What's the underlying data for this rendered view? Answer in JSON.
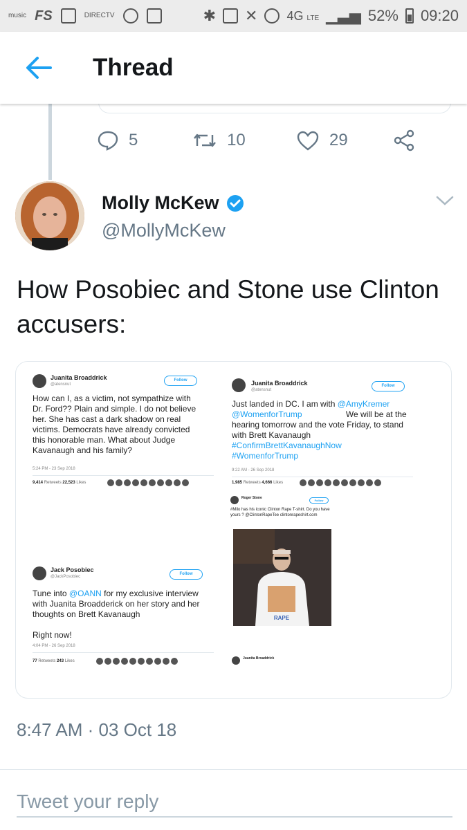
{
  "status_bar": {
    "left_tiny": "music",
    "left_fs": "FS",
    "left_directv": "DIRECTV",
    "network": "4G",
    "network_sub": "LTE",
    "battery": "52%",
    "time": "09:20"
  },
  "header": {
    "title": "Thread"
  },
  "previous_tweet": {
    "replies": "5",
    "retweets": "10",
    "likes": "29"
  },
  "tweet": {
    "author_name": "Molly McKew",
    "handle": "@MollyMcKew",
    "verified": true,
    "text": "How Posobiec and Stone use Clinton accusers:",
    "timestamp": "8:47 AM · 03 Oct 18"
  },
  "embedded": {
    "t1": {
      "name": "Juanita Broaddrick",
      "handle": "@atensnut",
      "follow": "Follow",
      "body": "How can I, as a victim, not sympathize with Dr. Ford?? Plain and simple. I do not believe her.  She has cast a dark shadow on real victims. Democrats have already convicted this honorable man.  What about Judge Kavanaugh and his family?",
      "date": "5:24 PM - 23 Sep 2018",
      "retweets": "9,414",
      "retweets_label": "Retweets",
      "likes": "22,523",
      "likes_label": "Likes"
    },
    "t2": {
      "name": "Juanita Broaddrick",
      "handle": "@atensnut",
      "follow": "Follow",
      "body_1": "Just landed in DC. I am with ",
      "mention_1": "@AmyKremer",
      "mention_2": "@WomenforTrump",
      "body_2": "We will be at the hearing tomorrow and the vote Friday, to stand with Brett Kavanaugh",
      "hashtag_1": "#ConfirmBrettKavanaughNow",
      "hashtag_2": "#WomenforTrump",
      "date": "9:22 AM - 26 Sep 2018",
      "retweets": "1,985",
      "retweets_label": "Retweets",
      "likes": "4,666",
      "likes_label": "Likes"
    },
    "t3": {
      "name": "Roger Stone",
      "follow": "Follow",
      "body": "#Milo has his iconic Clinton Rape T-shirt. Do you have yours ? @ClintonRapeTee clintonrapeshirt.com",
      "shirt_text": "RAPE"
    },
    "t4": {
      "name": "Jack Posobiec",
      "handle": "@JackPosobiec",
      "follow": "Follow",
      "body_1": "Tune into ",
      "mention": "@OANN",
      "body_2": " for my exclusive interview with Juanita Broadderick on her story and her thoughts on Brett Kavanaugh",
      "body_3": "Right now!",
      "date": "4:04 PM - 26 Sep 2018",
      "retweets": "77",
      "retweets_label": "Retweets",
      "likes": "243",
      "likes_label": "Likes"
    },
    "t5": {
      "name": "Juanita Broaddrick"
    }
  },
  "reply": {
    "placeholder": "Tweet your reply"
  },
  "colors": {
    "accent": "#1da1f2",
    "text": "#14171a",
    "secondary": "#657786"
  }
}
